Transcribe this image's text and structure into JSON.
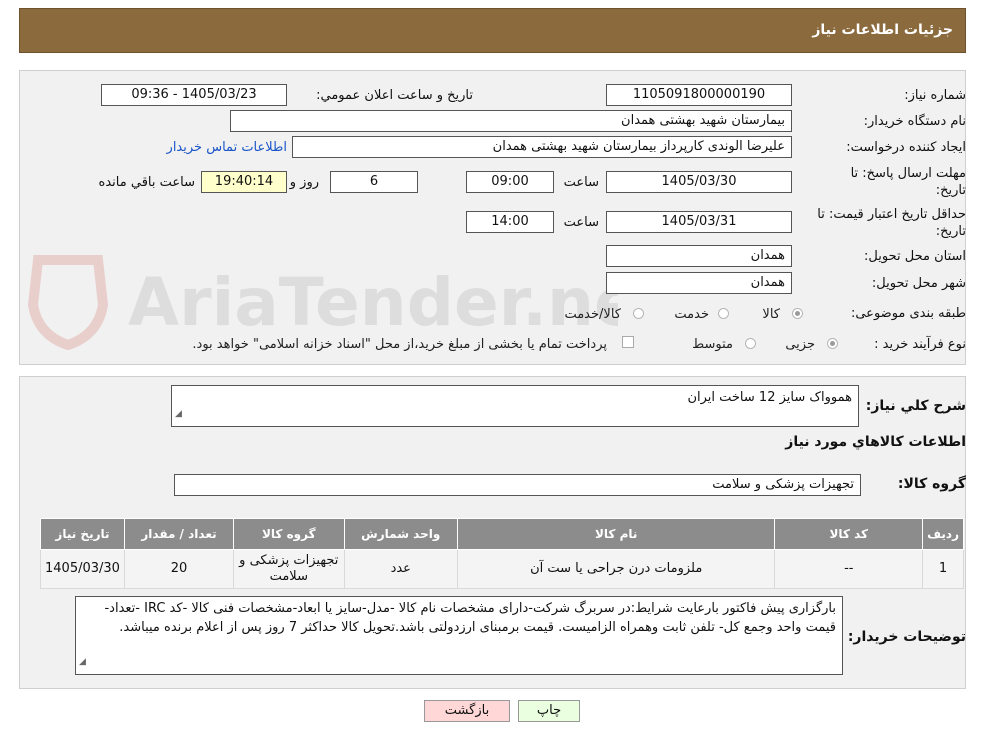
{
  "header": {
    "title": "جزئیات اطلاعات نیاز"
  },
  "details": {
    "need_number": {
      "label": "شماره نیاز:",
      "value": "1105091800000190"
    },
    "announce": {
      "label": "تاریخ و ساعت اعلان عمومي:",
      "value": "1405/03/23 - 09:36"
    },
    "buyer_org": {
      "label": "نام دستگاه خریدار:",
      "value": "بیمارستان شهید بهشتی همدان"
    },
    "creator": {
      "label": "ایجاد کننده درخواست:",
      "value": "علیرضا الوندی کارپرداز بیمارستان شهید بهشتی همدان",
      "contact_link": "اطلاعات تماس خریدار"
    },
    "deadline": {
      "label_line1": "مهلت ارسال پاسخ: تا",
      "label_line2": "تاریخ:",
      "date": "1405/03/30",
      "time_label": "ساعت",
      "time": "09:00",
      "days": "6",
      "days_label": "روز و",
      "remaining": "19:40:14",
      "remaining_label": "ساعت باقي مانده"
    },
    "validity": {
      "label_line1": "حداقل تاریخ اعتبار قیمت: تا",
      "label_line2": "تاریخ:",
      "date": "1405/03/31",
      "time_label": "ساعت",
      "time": "14:00"
    },
    "province": {
      "label": "استان محل تحویل:",
      "value": "همدان"
    },
    "city": {
      "label": "شهر محل تحویل:",
      "value": "همدان"
    },
    "category": {
      "label": "طبقه بندی موضوعی:",
      "options": [
        "کالا",
        "خدمت",
        "کالا/خدمت"
      ],
      "selected": "کالا"
    },
    "process": {
      "label": "نوع فرآیند خرید :",
      "options": [
        "جزیی",
        "متوسط"
      ],
      "selected": "جزیی",
      "payment_note": "پرداخت تمام یا بخشی از مبلغ خرید،از محل \"اسناد خزانه اسلامی\" خواهد بود."
    }
  },
  "summary": {
    "label": "شرح کلي نیاز:",
    "value": "هموواک سایز 12 ساخت ایران",
    "goods_info_title": "اطلاعات کالاهاي مورد نیاز",
    "group_label": "گروه کالا:",
    "group_value": "تجهیزات پزشکی و سلامت"
  },
  "table": {
    "headers": [
      "ردیف",
      "کد کالا",
      "نام کالا",
      "واحد شمارش",
      "گروه کالا",
      "تعداد / مقدار",
      "تاریخ نیاز"
    ],
    "rows": [
      [
        "1",
        "--",
        "ملزومات درن جراحی یا ست آن",
        "عدد",
        "تجهیزات پزشکی و سلامت",
        "20",
        "1405/03/30"
      ]
    ]
  },
  "notes": {
    "label": "توضیحات خریدار:",
    "value": "بارگزاری پیش فاکتور بارعایت شرایط:در سربرگ شرکت-دارای مشخصات نام کالا -مدل-سایز یا ابعاد-مشخصات فنی کالا -کد IRC -تعداد-قیمت واحد وجمع کل- تلفن ثابت وهمراه الزامیست. قیمت برمبنای ارزدولتی باشد.تحویل کالا حداکثر 7 روز پس از اعلام برنده میباشد."
  },
  "buttons": {
    "print": "چاپ",
    "back": "بازگشت"
  },
  "watermark_text": "AriaTender.neT",
  "colors": {
    "header_bg": "#8b6a3e",
    "table_header_bg": "#8c8c8c",
    "remaining_bg": "#ffffcc",
    "back_btn_bg": "#ffd7d7",
    "print_btn_bg": "#e9ffe0",
    "link": "#1a55c8"
  }
}
